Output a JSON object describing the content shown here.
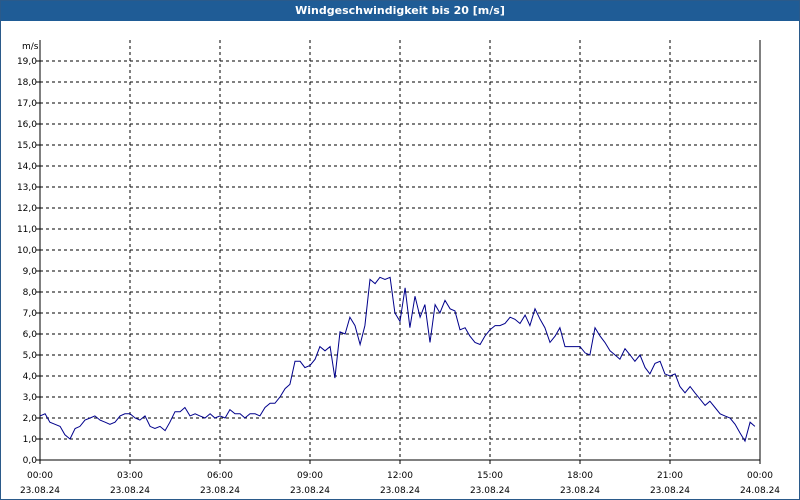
{
  "window": {
    "title": "Windgeschwindigkeit bis 20 [m/s]"
  },
  "chart_data": {
    "type": "line",
    "title": "Windgeschwindigkeit bis 20 [m/s]",
    "ylabel": "m/s",
    "xlabel": "",
    "ylim": [
      0,
      20
    ],
    "xlim_hours": [
      0,
      24
    ],
    "grid": true,
    "y_ticks": [
      "0,0",
      "1,0",
      "2,0",
      "3,0",
      "4,0",
      "5,0",
      "6,0",
      "7,0",
      "8,0",
      "9,0",
      "10,0",
      "11,0",
      "12,0",
      "13,0",
      "14,0",
      "15,0",
      "16,0",
      "17,0",
      "18,0",
      "19,0"
    ],
    "x_ticks": [
      {
        "time": "00:00",
        "date": "23.08.24"
      },
      {
        "time": "03:00",
        "date": "23.08.24"
      },
      {
        "time": "06:00",
        "date": "23.08.24"
      },
      {
        "time": "09:00",
        "date": "23.08.24"
      },
      {
        "time": "12:00",
        "date": "23.08.24"
      },
      {
        "time": "15:00",
        "date": "23.08.24"
      },
      {
        "time": "18:00",
        "date": "23.08.24"
      },
      {
        "time": "21:00",
        "date": "23.08.24"
      },
      {
        "time": "00:00",
        "date": "24.08.24"
      }
    ],
    "series": [
      {
        "color": "#00008b",
        "x_hours": [
          0.0,
          0.17,
          0.33,
          0.5,
          0.67,
          0.83,
          1.0,
          1.17,
          1.33,
          1.5,
          1.67,
          1.83,
          2.0,
          2.17,
          2.33,
          2.5,
          2.67,
          2.83,
          3.0,
          3.17,
          3.33,
          3.5,
          3.67,
          3.83,
          4.0,
          4.17,
          4.33,
          4.5,
          4.67,
          4.83,
          5.0,
          5.17,
          5.33,
          5.5,
          5.67,
          5.83,
          6.0,
          6.17,
          6.33,
          6.5,
          6.67,
          6.83,
          7.0,
          7.17,
          7.33,
          7.5,
          7.67,
          7.83,
          8.0,
          8.17,
          8.33,
          8.5,
          8.67,
          8.83,
          9.0,
          9.17,
          9.33,
          9.5,
          9.67,
          9.83,
          10.0,
          10.17,
          10.33,
          10.5,
          10.67,
          10.83,
          11.0,
          11.17,
          11.33,
          11.5,
          11.67,
          11.83,
          12.0,
          12.17,
          12.33,
          12.5,
          12.67,
          12.83,
          13.0,
          13.17,
          13.33,
          13.5,
          13.67,
          13.83,
          14.0,
          14.17,
          14.33,
          14.5,
          14.67,
          14.83,
          15.0,
          15.17,
          15.33,
          15.5,
          15.67,
          15.83,
          16.0,
          16.17,
          16.33,
          16.5,
          16.67,
          16.83,
          17.0,
          17.17,
          17.33,
          17.5,
          17.67,
          17.83,
          18.0,
          18.17,
          18.33,
          18.5,
          18.67,
          18.83,
          19.0,
          19.17,
          19.33,
          19.5,
          19.67,
          19.83,
          20.0,
          20.17,
          20.33,
          20.5,
          20.67,
          20.83,
          21.0,
          21.17,
          21.33,
          21.5,
          21.67,
          21.83,
          22.0,
          22.17,
          22.33,
          22.5,
          22.67,
          22.83,
          23.0,
          23.17,
          23.33,
          23.5,
          23.67,
          23.83
        ],
        "values": [
          2.1,
          2.2,
          1.8,
          1.7,
          1.6,
          1.2,
          1.0,
          1.5,
          1.6,
          1.9,
          2.0,
          2.1,
          1.9,
          1.8,
          1.7,
          1.8,
          2.1,
          2.2,
          2.2,
          2.0,
          1.9,
          2.1,
          1.6,
          1.5,
          1.6,
          1.4,
          1.8,
          2.3,
          2.3,
          2.5,
          2.1,
          2.2,
          2.1,
          2.0,
          2.2,
          2.0,
          2.1,
          2.0,
          2.4,
          2.2,
          2.2,
          2.0,
          2.2,
          2.2,
          2.1,
          2.5,
          2.7,
          2.7,
          3.0,
          3.4,
          3.6,
          4.7,
          4.7,
          4.4,
          4.5,
          4.8,
          5.4,
          5.2,
          5.4,
          3.9,
          6.1,
          6.0,
          6.8,
          6.4,
          5.5,
          6.4,
          8.6,
          8.4,
          8.7,
          8.6,
          8.7,
          7.0,
          6.6,
          8.2,
          6.3,
          7.8,
          6.8,
          7.4,
          5.6,
          7.4,
          7.0,
          7.6,
          7.2,
          7.1,
          6.2,
          6.3,
          5.9,
          5.6,
          5.5,
          5.9,
          6.2,
          6.4,
          6.4,
          6.5,
          6.8,
          6.7,
          6.5,
          6.9,
          6.4,
          7.2,
          6.7,
          6.3,
          5.6,
          5.9,
          6.3,
          5.4,
          5.4,
          5.4,
          5.4,
          5.1,
          5.0,
          6.3,
          5.9,
          5.6,
          5.2,
          5.0,
          4.8,
          5.3,
          5.0,
          4.7,
          5.0,
          4.4,
          4.1,
          4.6,
          4.7,
          4.1,
          4.0,
          4.1,
          3.5,
          3.2,
          3.5,
          3.2,
          2.9,
          2.6,
          2.8,
          2.5,
          2.2,
          2.1,
          2.0,
          1.7,
          1.3,
          0.9,
          1.8,
          1.6,
          1.9,
          1.5,
          1.5
        ]
      }
    ]
  }
}
